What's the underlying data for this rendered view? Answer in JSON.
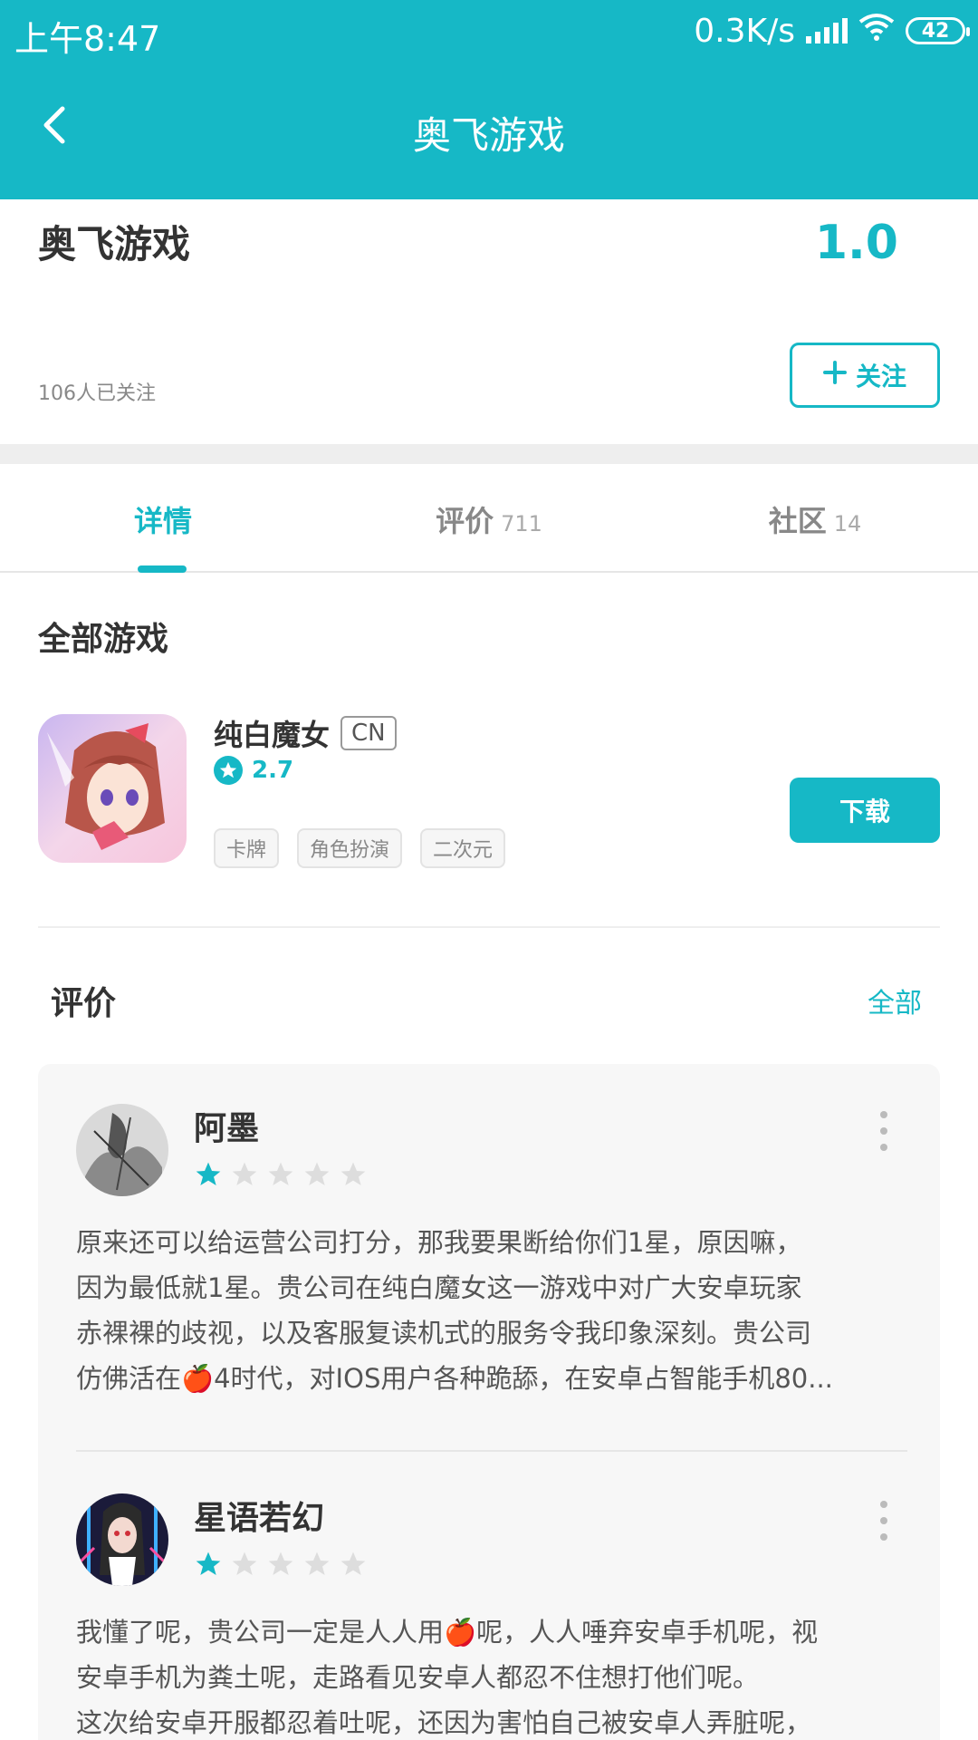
{
  "status_bar": {
    "time": "上午8:47",
    "network_speed": "0.3K/s",
    "battery": "42"
  },
  "nav": {
    "title": "奥飞游戏",
    "back_icon": "chevron-left-icon"
  },
  "developer": {
    "name": "奥飞游戏",
    "score": "1.0",
    "followers": "106人已关注",
    "follow_label": "关注"
  },
  "tabs": [
    {
      "label": "详情",
      "count": "",
      "active": true
    },
    {
      "label": "评价",
      "count": "711",
      "active": false
    },
    {
      "label": "社区",
      "count": "14",
      "active": false
    }
  ],
  "all_games": {
    "title": "全部游戏",
    "game": {
      "name": "纯白魔女",
      "region": "CN",
      "rating": "2.7",
      "tags": [
        "卡牌",
        "角色扮演",
        "二次元"
      ],
      "download_label": "下载"
    }
  },
  "reviews": {
    "title": "评价",
    "all_label": "全部",
    "items": [
      {
        "user": "阿墨",
        "rating": 1,
        "max_rating": 5,
        "lines": [
          "原来还可以给运营公司打分，那我要果断给你们1星，原因嘛，",
          "因为最低就1星。贵公司在纯白魔女这一游戏中对广大安卓玩家",
          "赤裸裸的歧视，以及客服复读机式的服务令我印象深刻。贵公司",
          "仿佛活在🍎4时代，对IOS用户各种跪舔，在安卓占智能手机80..."
        ]
      },
      {
        "user": "星语若幻",
        "rating": 1,
        "max_rating": 5,
        "lines": [
          "我懂了呢，贵公司一定是人人用🍎呢，人人唾弃安卓手机呢，视",
          "安卓手机为粪土呢，走路看见安卓人都忍不住想打他们呢。",
          "这次给安卓开服都忍着吐呢，还因为害怕自己被安卓人弄脏呢，"
        ]
      }
    ]
  },
  "colors": {
    "accent": "#16b8c6",
    "text": "#333333",
    "muted": "#888888"
  }
}
